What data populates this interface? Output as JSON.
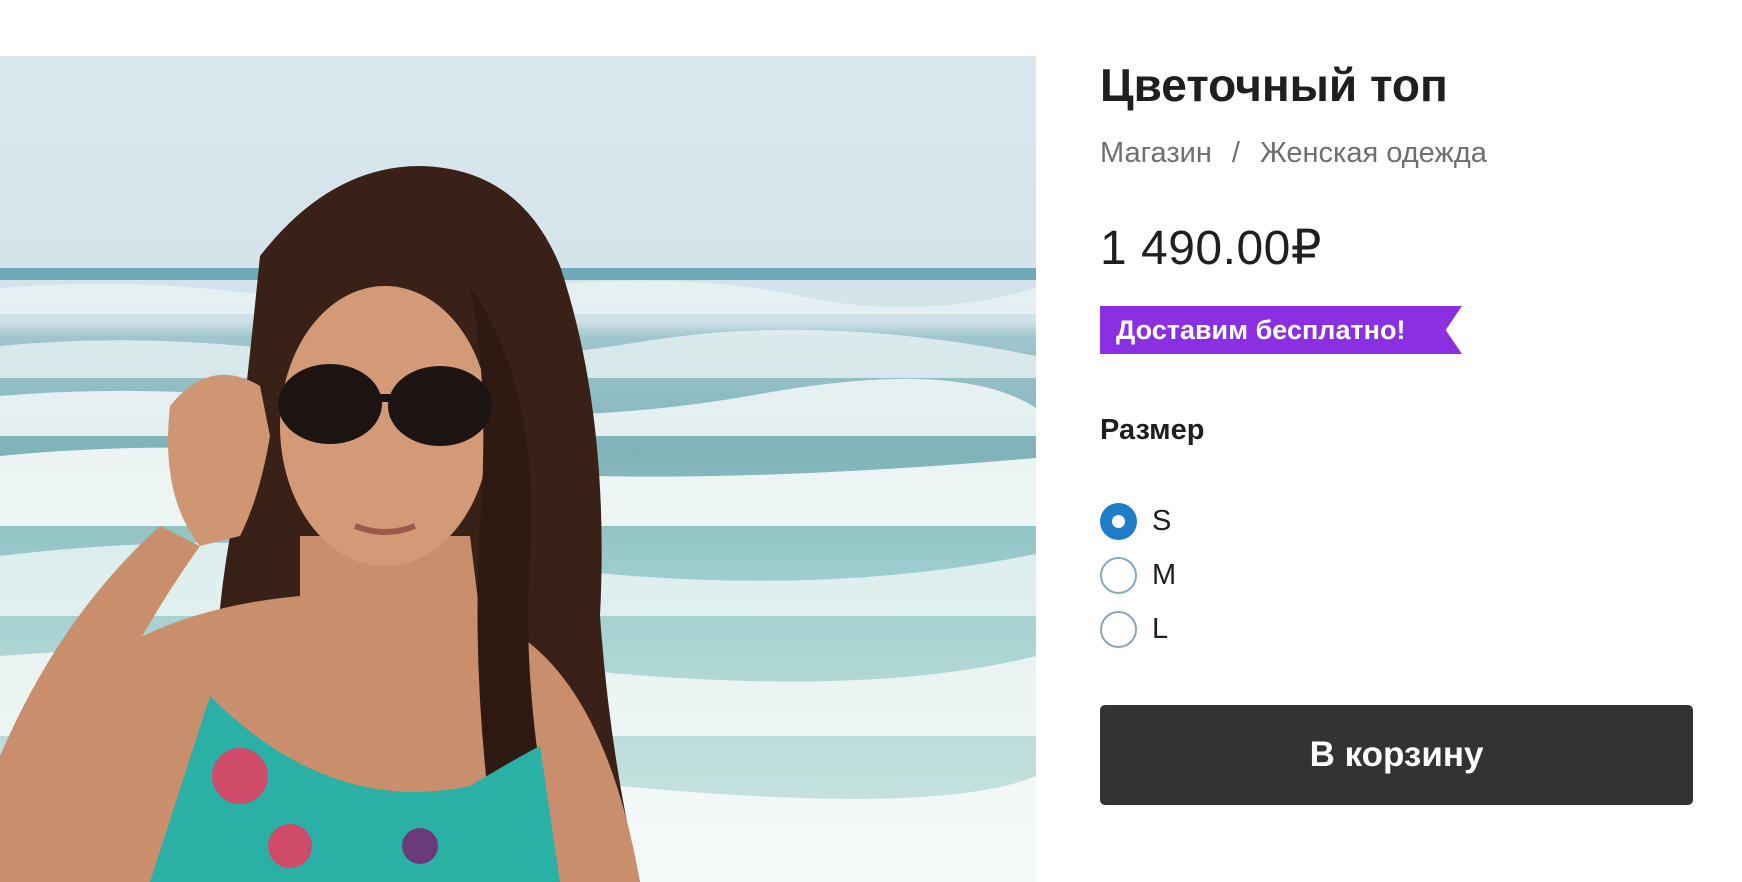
{
  "product": {
    "title": "Цветочный топ",
    "price": "1 490.00₽",
    "promo_ribbon": "Доставим бесплатно!",
    "image_icon": "beach-woman-sunglasses-photo"
  },
  "breadcrumb": {
    "items": [
      "Магазин",
      "Женская одежда"
    ],
    "separator": "/"
  },
  "size": {
    "label": "Размер",
    "options": [
      {
        "label": "S",
        "checked": true
      },
      {
        "label": "M",
        "checked": false
      },
      {
        "label": "L",
        "checked": false
      }
    ]
  },
  "actions": {
    "add_to_cart": "В корзину"
  },
  "colors": {
    "ribbon": "#8b2fe3",
    "radio_checked": "#1e7cc9",
    "button": "#333333"
  }
}
